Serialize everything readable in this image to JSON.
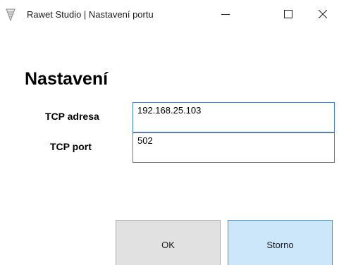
{
  "window": {
    "title": "Rawet Studio | Nastavení portu",
    "app_icon": "app-icon"
  },
  "title_controls": {
    "minimize_icon": "minimize-icon",
    "maximize_icon": "maximize-icon",
    "close_icon": "close-icon"
  },
  "form": {
    "heading": "Nastavení",
    "tcp_address_label": "TCP adresa",
    "tcp_address_value": "192.168.25.103",
    "tcp_port_label": "TCP port",
    "tcp_port_value": "502"
  },
  "buttons": {
    "ok_label": "OK",
    "cancel_label": "Storno"
  },
  "colors": {
    "focus_border": "#3c7fd9",
    "ok_background": "#e1e1e1",
    "cancel_background": "#cce7fa"
  }
}
